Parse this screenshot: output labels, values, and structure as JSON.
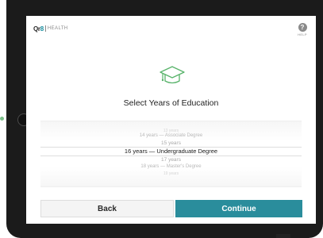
{
  "header": {
    "logo_brand": "Qr",
    "logo_brand_accent": "8",
    "logo_text": "HEALTH",
    "help_symbol": "?",
    "help_label": "HELP"
  },
  "icons": {
    "main": "graduation-cap-icon",
    "help": "question-mark-icon"
  },
  "colors": {
    "accent": "#2a8d9c",
    "icon_green": "#58b36a"
  },
  "main": {
    "title": "Select Years of Education",
    "picker": {
      "options": [
        "13 years",
        "14 years — Associate Degree",
        "15 years",
        "16 years — Undergraduate Degree",
        "17 years",
        "18 years — Master's Degree",
        "19 years"
      ],
      "selected": "16 years — Undergraduate Degree"
    }
  },
  "footer": {
    "back_label": "Back",
    "continue_label": "Continue"
  }
}
